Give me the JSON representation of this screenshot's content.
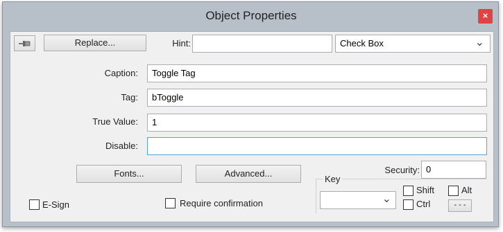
{
  "window": {
    "title": "Object Properties",
    "close_glyph": "×"
  },
  "toolbar": {
    "pin_icon": "pushpin-icon",
    "replace_label": "Replace...",
    "hint_label": "Hint:",
    "hint_value": "",
    "object_type": "Check Box",
    "dropdown_glyph": "⌄"
  },
  "fields": {
    "caption_label": "Caption:",
    "caption_value": "Toggle Tag",
    "tag_label": "Tag:",
    "tag_value": "bToggle",
    "true_value_label": "True Value:",
    "true_value_value": "1",
    "disable_label": "Disable:",
    "disable_value": ""
  },
  "buttons": {
    "fonts_label": "Fonts...",
    "advanced_label": "Advanced..."
  },
  "security": {
    "label": "Security:",
    "value": "0"
  },
  "key_group": {
    "label": "Key",
    "key_value": "",
    "shift_label": "Shift",
    "alt_label": "Alt",
    "ctrl_label": "Ctrl",
    "more_label": "- - -"
  },
  "options": {
    "esign_label": "E-Sign",
    "require_confirmation_label": "Require confirmation"
  }
}
